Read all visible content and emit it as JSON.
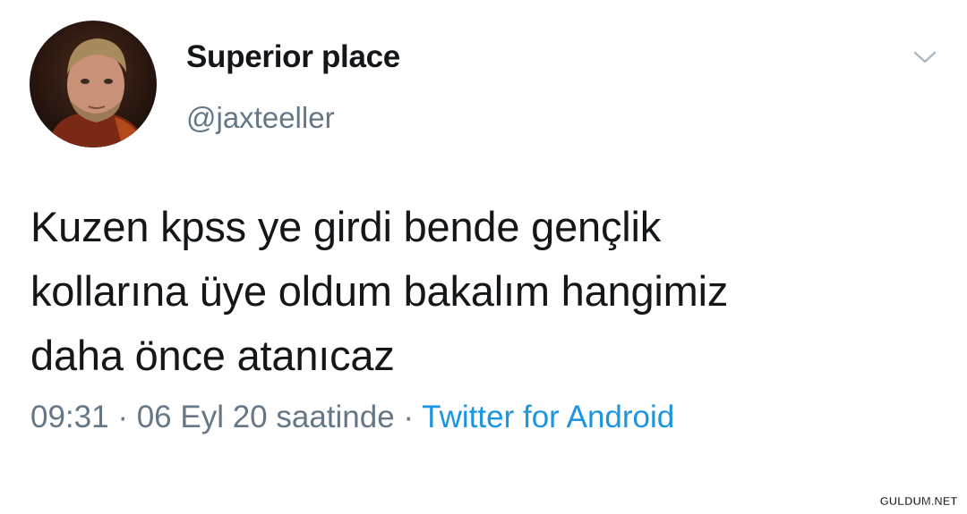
{
  "tweet": {
    "author": {
      "display_name": "Superior place",
      "handle": "@jaxteeller",
      "avatar_icon": "profile-photo"
    },
    "menu_icon": "chevron-down-icon",
    "text_lines": [
      "Kuzen kpss ye girdi bende gençlik",
      "kollarına üye oldum bakalım hangimiz",
      "daha önce atanıcaz"
    ],
    "meta": {
      "time": "09:31",
      "separator": " · ",
      "date": "06 Eyl 20 saatinde",
      "separator2": " · ",
      "source": "Twitter for Android"
    }
  },
  "watermark": "GULDUM.NET",
  "colors": {
    "text": "#14171a",
    "secondary": "#657786",
    "link": "#1b95e0",
    "background": "#ffffff"
  }
}
